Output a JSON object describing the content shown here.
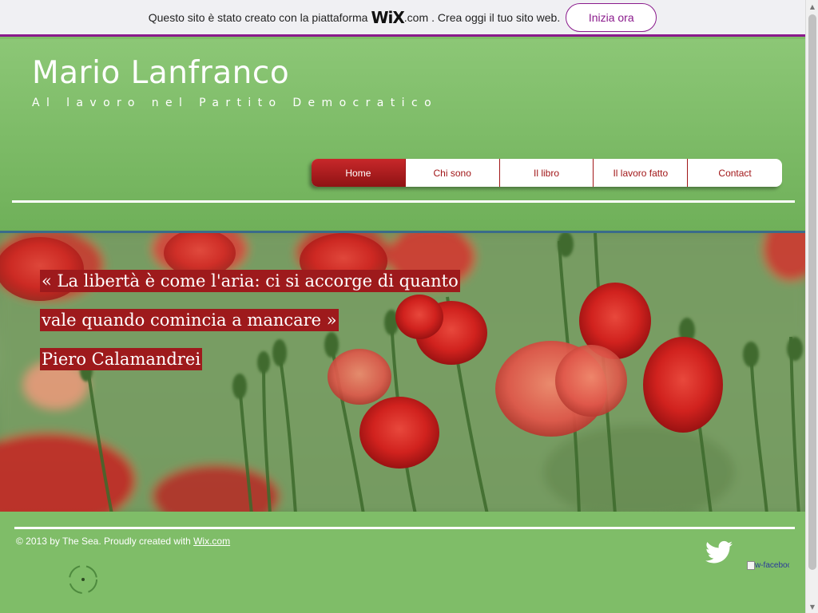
{
  "wix_banner": {
    "message_start": "Questo sito è stato creato con la piattaforma",
    "logo": "WiX",
    "dotcom": ".com",
    "message_end": ". Crea oggi il tuo sito web.",
    "cta_label": "Inizia ora"
  },
  "header": {
    "title": "Mario Lanfranco",
    "subtitle": "Al lavoro nel Partito Democratico"
  },
  "nav": {
    "items": [
      {
        "label": "Home",
        "active": true
      },
      {
        "label": "Chi sono",
        "active": false
      },
      {
        "label": "Il libro",
        "active": false
      },
      {
        "label": "Il lavoro fatto",
        "active": false
      },
      {
        "label": "Contact",
        "active": false
      }
    ]
  },
  "hero": {
    "quote_line1": "« La libertà è come l'aria: ci si accorge di quanto",
    "quote_line2": "vale quando comincia a mancare »",
    "author": "Piero Calamandrei"
  },
  "footer": {
    "copyright": "© 2013 by The Sea. Proudly created with ",
    "link": "Wix.com",
    "facebook_alt": "w-facebook"
  },
  "icons": {
    "twitter": "twitter-icon",
    "facebook": "broken-image-icon",
    "spinner": "loading-spinner-icon"
  },
  "colors": {
    "accent": "#8a1a8c",
    "nav_red": "#a11618",
    "green": "#7fbd68"
  }
}
